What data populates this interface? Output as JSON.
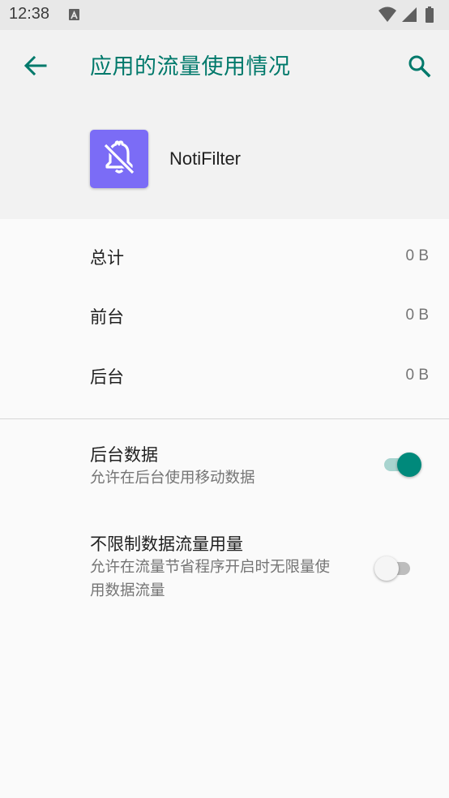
{
  "status_bar": {
    "time": "12:38",
    "icons": [
      "notification-a-icon",
      "wifi-icon",
      "signal-icon",
      "battery-icon"
    ]
  },
  "app_bar": {
    "title": "应用的流量使用情况",
    "back_icon": "arrow-back-icon",
    "search_icon": "search-icon"
  },
  "app": {
    "name": "NotiFilter",
    "icon": "bell-off-icon",
    "icon_color": "#7b6cf6"
  },
  "usage": [
    {
      "label": "总计",
      "value": "0 B"
    },
    {
      "label": "前台",
      "value": "0 B"
    },
    {
      "label": "后台",
      "value": "0 B"
    }
  ],
  "settings": {
    "background_data": {
      "title": "后台数据",
      "summary": "允许在后台使用移动数据",
      "enabled": true
    },
    "unrestricted_data": {
      "title": "不限制数据流量用量",
      "summary": "允许在流量节省程序开启时无限量使用数据流量",
      "enabled": false
    }
  },
  "colors": {
    "accent": "#00796b",
    "switch_on": "#00897b"
  }
}
